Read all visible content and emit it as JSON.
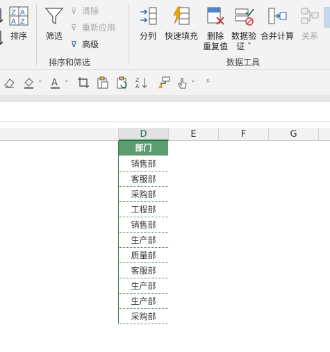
{
  "ribbon": {
    "sort_label": "排序",
    "filter_label": "筛选",
    "clear_label": "清除",
    "reapply_label": "重新应用",
    "advanced_label": "高级",
    "sort_filter_group": "排序和筛选",
    "split_label": "分列",
    "flash_fill_label": "快速填充",
    "remove_dup_line1": "删除",
    "remove_dup_line2": "重复值",
    "validation_line1": "数据验",
    "validation_line2": "证 ˇ",
    "consolidate_label": "合并计算",
    "relations_label": "关系",
    "data_tools_group": "数据工具"
  },
  "columns": [
    "D",
    "E",
    "F",
    "G"
  ],
  "table": {
    "header": "部门",
    "rows": [
      "销售部",
      "客服部",
      "采购部",
      "工程部",
      "销售部",
      "生产部",
      "质量部",
      "客服部",
      "生产部",
      "生产部",
      "采购部"
    ]
  },
  "colors": {
    "accent": "#217346",
    "header_fill": "#5a9c6e"
  }
}
